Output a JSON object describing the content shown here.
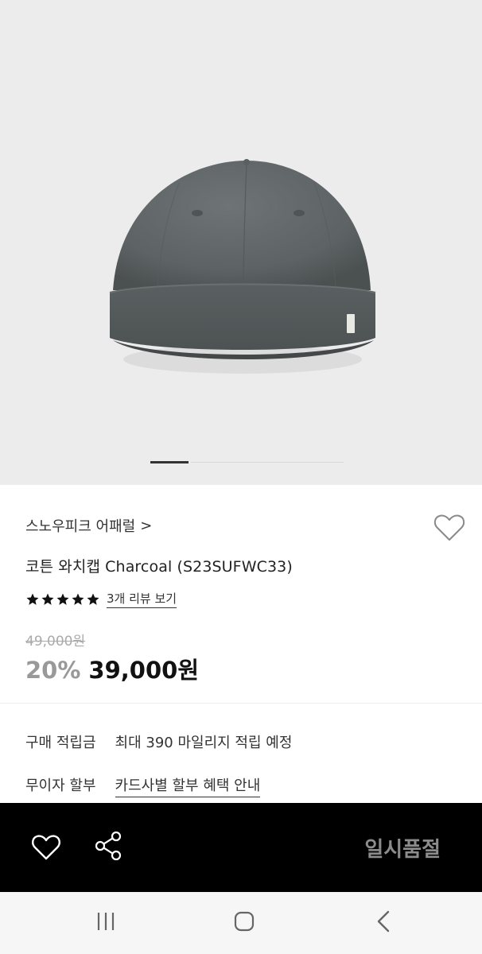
{
  "product": {
    "brand": "스노우피크 어패럴",
    "brand_chevron": ">",
    "title": "코튼 와치캡 Charcoal (S23SUFWC33)",
    "rating_stars": 5,
    "review_link": "3개 리뷰 보기",
    "original_price": "49,000원",
    "discount": "20%",
    "price": "39,000원"
  },
  "image": {
    "slide_count": 5,
    "active_slide": 1,
    "cap_color": "#5f6566"
  },
  "benefits": [
    {
      "label": "구매 적립금",
      "value": "최대 390 마일리지 적립 예정"
    },
    {
      "label": "무이자 할부",
      "value": "카드사별 할부 혜택 안내"
    }
  ],
  "bottom_bar": {
    "wishlist_icon": "heart-icon",
    "share_icon": "share-icon",
    "status_label": "일시품절"
  },
  "system_nav": {
    "recent_icon": "recent-apps-icon",
    "home_icon": "home-icon",
    "back_icon": "back-icon"
  },
  "colors": {
    "bottom_bar_bg": "#000000",
    "soldout_text": "#8c8c8c",
    "discount_text": "#999999"
  }
}
